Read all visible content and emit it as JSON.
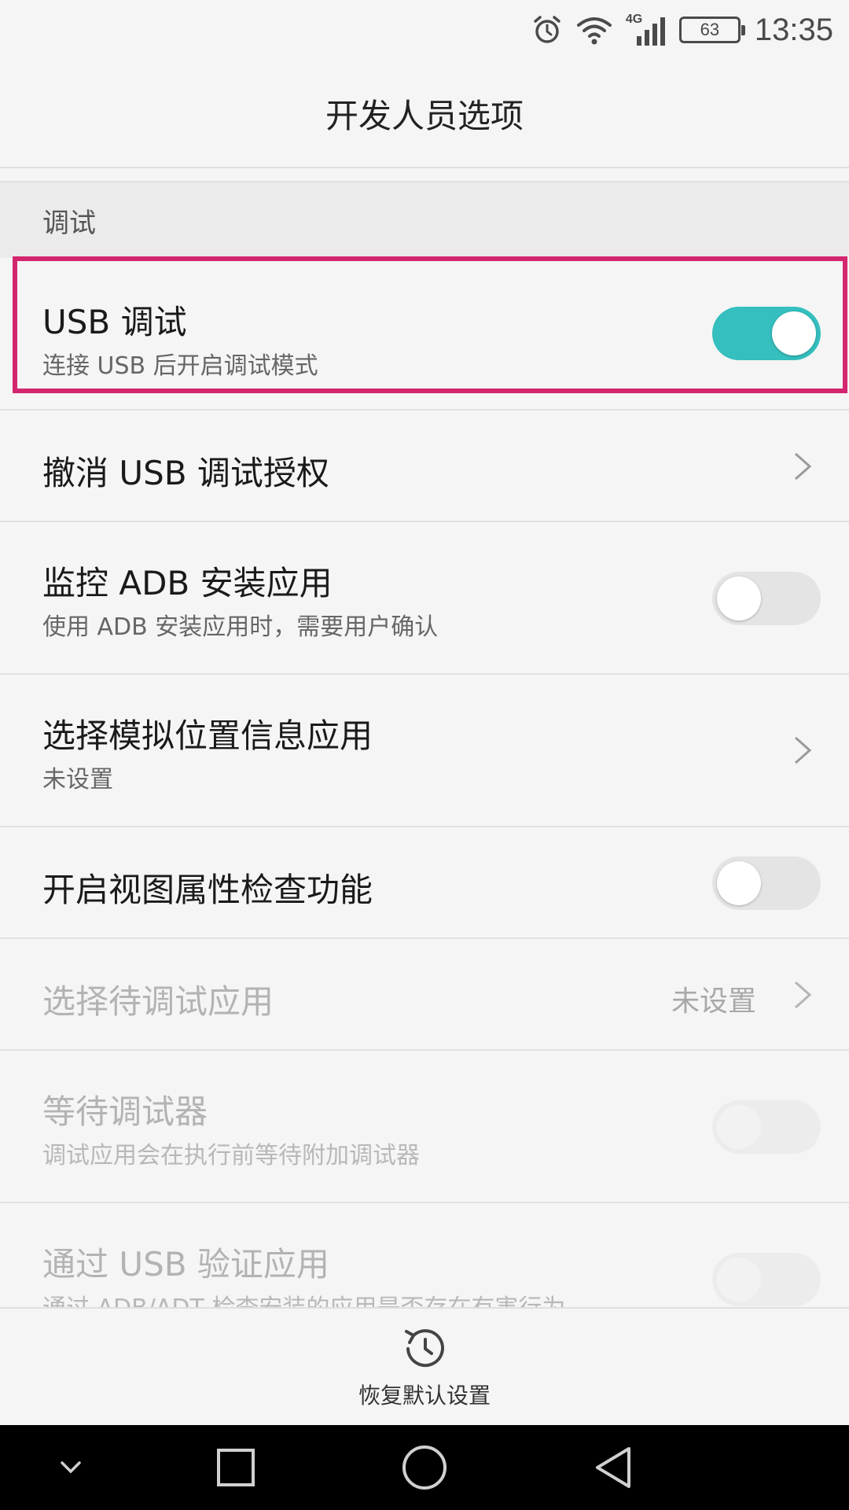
{
  "status_bar": {
    "network_type": "4G",
    "battery_level": "63",
    "time": "13:35",
    "icons": [
      "alarm-icon",
      "wifi-icon",
      "cellular-signal-icon",
      "battery-icon"
    ]
  },
  "header": {
    "title": "开发人员选项"
  },
  "section": {
    "title": "调试"
  },
  "items": [
    {
      "title": "USB 调试",
      "subtitle": "连接 USB 后开启调试模式",
      "control": "toggle",
      "checked": true,
      "enabled": true,
      "highlighted": true
    },
    {
      "title": "撤消 USB 调试授权",
      "control": "chevron",
      "enabled": true
    },
    {
      "title": "监控 ADB 安装应用",
      "subtitle": "使用 ADB 安装应用时，需要用户确认",
      "control": "toggle",
      "checked": false,
      "enabled": true
    },
    {
      "title": "选择模拟位置信息应用",
      "subtitle": "未设置",
      "control": "chevron",
      "enabled": true
    },
    {
      "title": "开启视图属性检查功能",
      "control": "toggle",
      "checked": false,
      "enabled": true
    },
    {
      "title": "选择待调试应用",
      "value": "未设置",
      "control": "chevron",
      "enabled": false
    },
    {
      "title": "等待调试器",
      "subtitle": "调试应用会在执行前等待附加调试器",
      "control": "toggle",
      "checked": false,
      "enabled": false
    },
    {
      "title": "通过 USB 验证应用",
      "subtitle": "通过 ADB/ADT 检查安装的应用是否存在有害行为",
      "control": "toggle",
      "checked": false,
      "enabled": false
    }
  ],
  "bottom_action": {
    "label": "恢复默认设置",
    "icon": "restore-history-icon"
  },
  "navigation_bar": {
    "buttons": [
      "collapse-down-icon",
      "recents-square-icon",
      "home-circle-icon",
      "back-triangle-icon"
    ]
  },
  "colors": {
    "accent": "#35bfbf",
    "highlight_border": "#d4266e",
    "background": "#f5f5f5",
    "section_background": "#ebebeb"
  }
}
